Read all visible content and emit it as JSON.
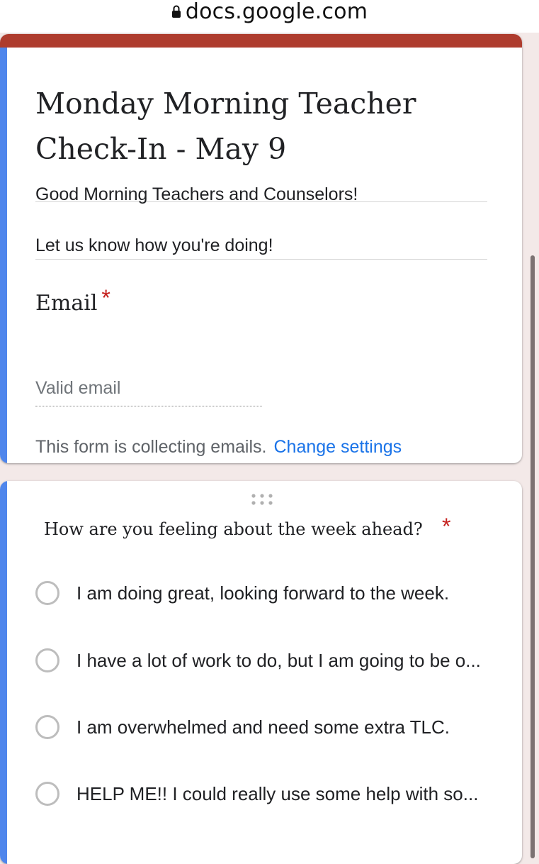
{
  "browser": {
    "url": "docs.google.com"
  },
  "form": {
    "title": "Monday Morning Teacher Check-In - May 9",
    "description": {
      "line1": "Good Morning Teachers and Counselors!",
      "line2": "Let us know how you're doing!"
    },
    "email": {
      "label": "Email",
      "required_mark": "*",
      "placeholder": "Valid email",
      "collecting_text": "This form is collecting emails.",
      "change_settings": "Change settings"
    }
  },
  "question": {
    "text": "How are you feeling about the week ahead?",
    "required_mark": "*",
    "options": [
      "I am doing great, looking forward to the week.",
      "I have a lot of work to do, but I am going to be o...",
      "I am overwhelmed and need some extra TLC.",
      "HELP ME!! I could really use some help with so..."
    ]
  },
  "colors": {
    "theme_header": "#ae3c2e",
    "accent_bar": "#4f86ec",
    "link": "#1a73e8",
    "required": "#c5221f",
    "background": "#f3e9e8"
  },
  "icons": [
    "lock-icon",
    "drag-handle-icon",
    "radio-icon"
  ]
}
